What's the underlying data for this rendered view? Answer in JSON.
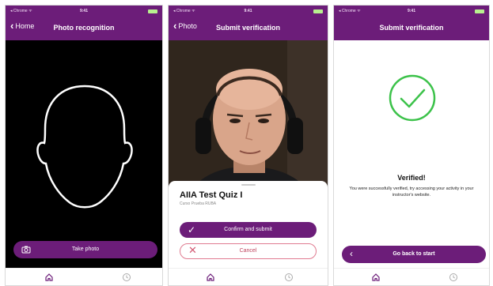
{
  "colors": {
    "accent": "#6c1d79",
    "success": "#3cc24a",
    "danger": "#d35a74"
  },
  "screens": [
    {
      "status": {
        "carrier": "◂ Chrome ᯤ",
        "time": "9:41"
      },
      "back_label": "Home",
      "title": "Photo recognition",
      "take_photo_label": "Take photo",
      "tabs": [
        {
          "icon": "home-icon"
        },
        {
          "icon": "clock-icon"
        }
      ]
    },
    {
      "status": {
        "carrier": "◂ Chrome ᯤ",
        "time": "9:41"
      },
      "back_label": "Photo",
      "title": "Submit verification",
      "quiz_title": "AIIA Test Quiz I",
      "quiz_subtitle": "Curso Prueba RUBA",
      "confirm_label": "Confirm and submit",
      "cancel_label": "Cancel",
      "tabs": [
        {
          "icon": "home-icon"
        },
        {
          "icon": "clock-icon"
        }
      ]
    },
    {
      "status": {
        "carrier": "◂ Chrome ᯤ",
        "time": "9:41"
      },
      "title": "Submit verification",
      "verified_title": "Verified!",
      "verified_message": "You were successfully verified, try accessing your activity in your instructor's website.",
      "go_back_label": "Go back to start",
      "tabs": [
        {
          "icon": "home-icon"
        },
        {
          "icon": "clock-icon"
        }
      ]
    }
  ]
}
